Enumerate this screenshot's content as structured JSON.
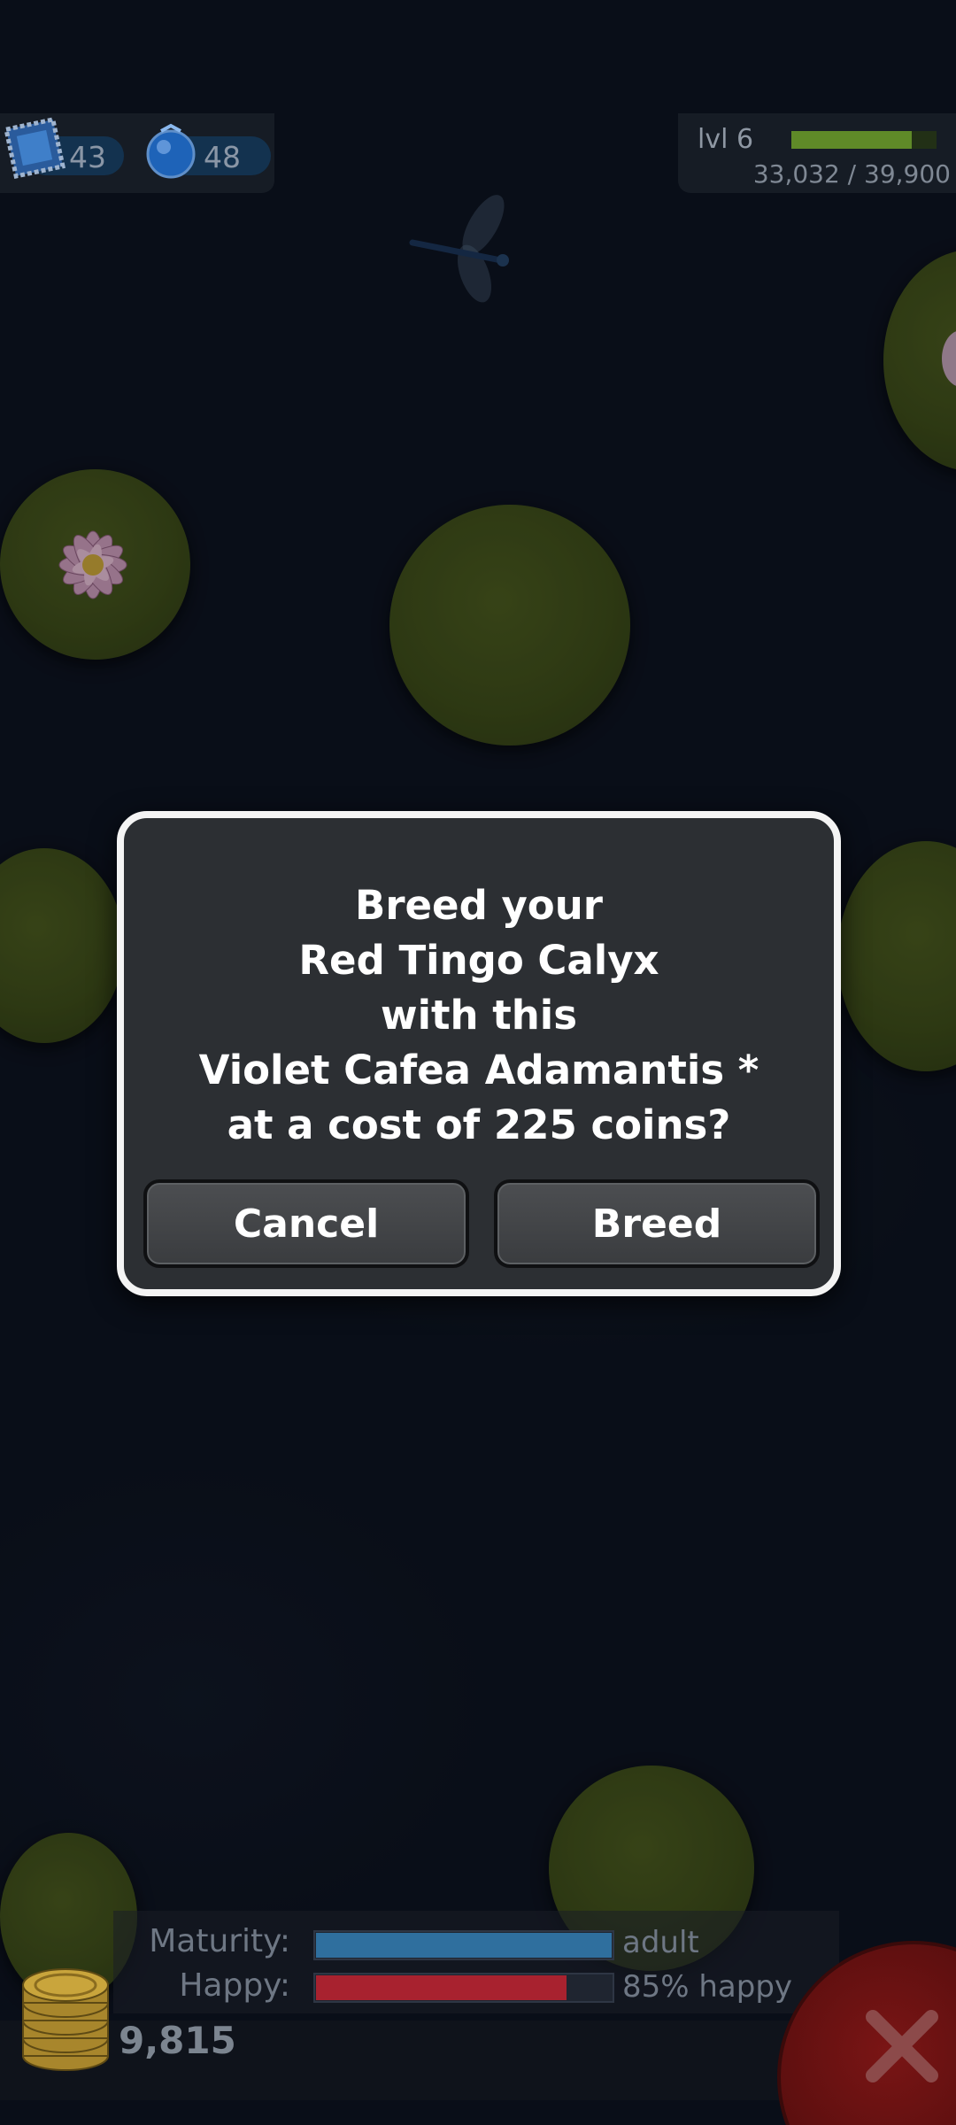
{
  "hud": {
    "stamps": "43",
    "orbs": "48",
    "level": "lvl 6",
    "xp_text": "33,032 / 39,900",
    "xp_fraction": 0.828
  },
  "dialog": {
    "lines": [
      "Breed your",
      "Red Tingo Calyx",
      "with this",
      "Violet Cafea Adamantis *",
      "at a cost of 225 coins?"
    ],
    "cancel_label": "Cancel",
    "confirm_label": "Breed"
  },
  "status": {
    "maturity_label": "Maturity:",
    "maturity_value": "adult",
    "maturity_fraction": 1.0,
    "happy_label": "Happy:",
    "happy_value": "85% happy",
    "happy_fraction": 0.85
  },
  "coins": "9,815",
  "colors": {
    "maturity_bar": "#2f6f9e",
    "happy_bar": "#a8222f",
    "xp_bar": "#5f8a28",
    "close_button": "#7a1515"
  },
  "icons": {
    "stamp": "blue-stamp-icon",
    "orb": "blue-orb-icon",
    "coins": "coin-stack-icon",
    "close": "close-x-icon",
    "flower": "water-lily-flower",
    "insect": "dragonfly"
  }
}
